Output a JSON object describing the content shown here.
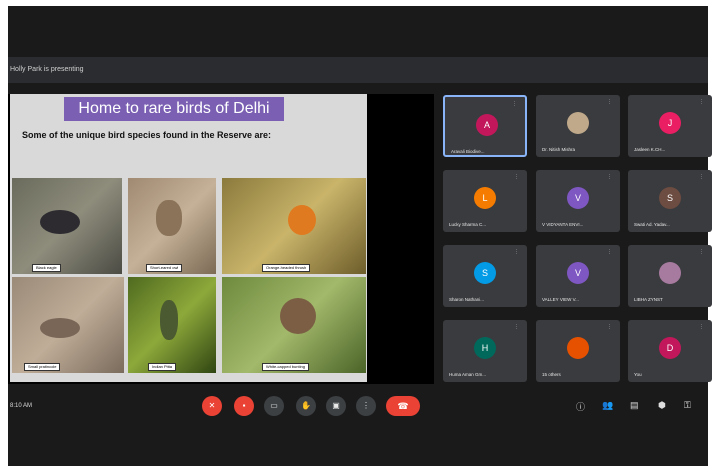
{
  "meeting": {
    "presenting_label": "Holly Park is presenting",
    "time_label": "8:10 AM"
  },
  "slide": {
    "title": "Home to rare birds of Delhi",
    "subtitle": "Some of the unique bird species found in the Reserve are:",
    "photos": [
      {
        "caption": "Black eagle"
      },
      {
        "caption": "Short-eared owl"
      },
      {
        "caption": "Orange-headed thrush"
      },
      {
        "caption": "Small pratincole"
      },
      {
        "caption": "Indian Pitta"
      },
      {
        "caption": "White-capped bunting"
      }
    ]
  },
  "participants": [
    {
      "initial": "A",
      "name": "Aravali Biodive...",
      "color": "#c2185b"
    },
    {
      "initial": "",
      "name": "Dr. Nitish Mishra",
      "color": "#bfa98a"
    },
    {
      "initial": "J",
      "name": "Jasleen K.CH...",
      "color": "#e91e63"
    },
    {
      "initial": "L",
      "name": "Lucky Sharma C...",
      "color": "#f57c00"
    },
    {
      "initial": "V",
      "name": "V VIDYANTA ENVI...",
      "color": "#7e57c2"
    },
    {
      "initial": "S",
      "name": "Swati Ad. Yadav...",
      "color": "#6d4c41"
    },
    {
      "initial": "S",
      "name": "Sharon Nathani...",
      "color": "#039be5"
    },
    {
      "initial": "V",
      "name": "VALLEY VIEW V...",
      "color": "#7e57c2"
    },
    {
      "initial": "",
      "name": "LIBHA ZYNST",
      "color": "#a77ba0"
    },
    {
      "initial": "H",
      "name": "Huma Aman Gm...",
      "color": "#00695c"
    },
    {
      "initial": "",
      "name": "15 others",
      "color": "#e65100"
    },
    {
      "initial": "D",
      "name": "You",
      "color": "#c2185b"
    }
  ],
  "controls": {
    "mic_icon": "mic-off-icon",
    "cam_icon": "camera-off-icon",
    "end_icon": "end-call-icon"
  }
}
